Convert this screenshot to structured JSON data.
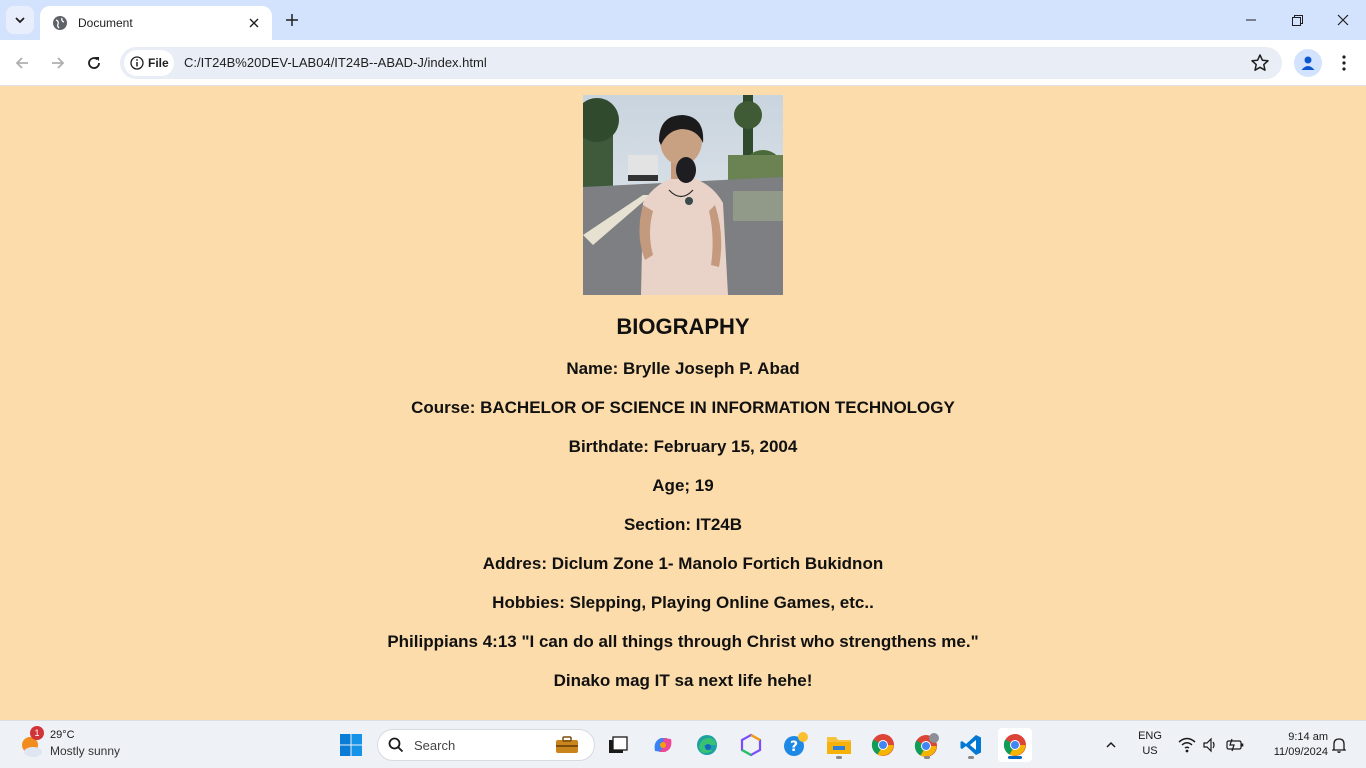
{
  "browser": {
    "tab_title": "Document",
    "url_chip_label": "File",
    "url": "C:/IT24B%20DEV-LAB04/IT24B--ABAD-J/index.html"
  },
  "page": {
    "heading": "BIOGRAPHY",
    "lines": [
      "Name: Brylle Joseph P. Abad",
      "Course: BACHELOR OF SCIENCE IN INFORMATION TECHNOLOGY",
      "Birthdate: February 15, 2004",
      "Age; 19",
      "Section: IT24B",
      "Addres: Diclum Zone 1- Manolo Fortich Bukidnon",
      "Hobbies: Slepping, Playing Online Games, etc..",
      "Philippians 4:13 \"I can do all things through Christ who strengthens me.\"",
      "Dinako mag IT sa next life hehe!"
    ],
    "background_color": "#fcdcaa"
  },
  "taskbar": {
    "weather_badge": "1",
    "weather_temp": "29°C",
    "weather_condition": "Mostly sunny",
    "search_placeholder": "Search",
    "lang_top": "ENG",
    "lang_bottom": "US",
    "time": "9:14 am",
    "date": "11/09/2024"
  }
}
